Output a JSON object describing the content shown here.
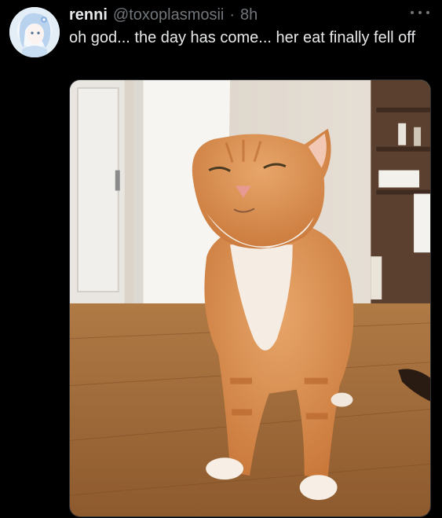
{
  "tweet": {
    "display_name": "renni",
    "handle": "@toxoplasmosii",
    "separator": "·",
    "time": "8h",
    "text": "oh god... the day has come... her eat finally fell off",
    "more_icon": "more-horizontal-icon"
  },
  "colors": {
    "background": "#000000",
    "primary_text": "#e7e9ea",
    "secondary_text": "#71767b"
  }
}
